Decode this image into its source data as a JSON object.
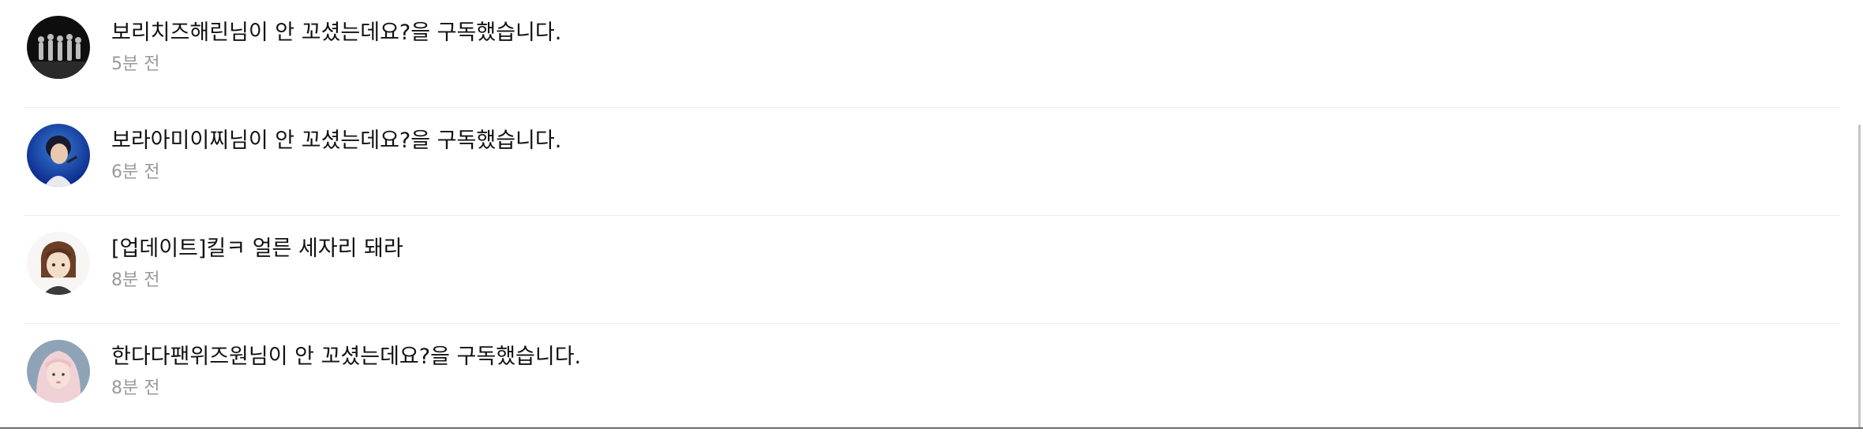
{
  "notifications": [
    {
      "message": "보리치즈해린님이 안 꼬셨는데요?을 구독했습니다.",
      "time": "5분 전",
      "avatar_icon": "group-photo-avatar"
    },
    {
      "message": "보라아미이찌님이 안 꼬셨는데요?을 구독했습니다.",
      "time": "6분 전",
      "avatar_icon": "singer-photo-avatar"
    },
    {
      "message": "[업데이트]킬ㅋ 얼른 세자리 돼라",
      "time": "8분 전",
      "avatar_icon": "illustration-avatar"
    },
    {
      "message": "한다다팬위즈원님이 안 꼬셨는데요?을 구독했습니다.",
      "time": "8분 전",
      "avatar_icon": "portrait-photo-avatar"
    }
  ]
}
